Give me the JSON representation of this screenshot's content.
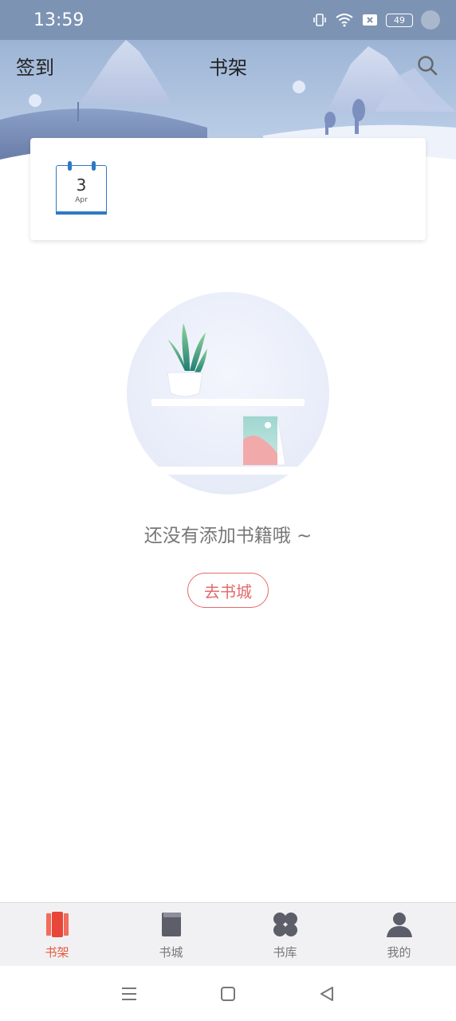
{
  "status_bar": {
    "time": "13:59",
    "battery": "49",
    "icons": [
      "vibrate-icon",
      "wifi-icon",
      "sim-off-icon",
      "battery-icon"
    ]
  },
  "header": {
    "checkin_label": "签到",
    "title": "书架",
    "search_icon": "search-icon"
  },
  "checkin_card": {
    "calendar_day": "3",
    "calendar_month": "Apr"
  },
  "empty_state": {
    "message": "还没有添加书籍哦 ~",
    "button_label": "去书城"
  },
  "tabbar": {
    "items": [
      {
        "label": "书架",
        "icon": "bookshelf-icon",
        "active": true
      },
      {
        "label": "书城",
        "icon": "book-icon",
        "active": false
      },
      {
        "label": "书库",
        "icon": "grid-icon",
        "active": false
      },
      {
        "label": "我的",
        "icon": "profile-icon",
        "active": false
      }
    ]
  },
  "system_nav": {
    "icons": [
      "menu-icon",
      "home-icon",
      "back-icon"
    ]
  },
  "colors": {
    "accent": "#e8583f",
    "button_red": "#e46a6a",
    "calendar_blue": "#2f79c4"
  }
}
